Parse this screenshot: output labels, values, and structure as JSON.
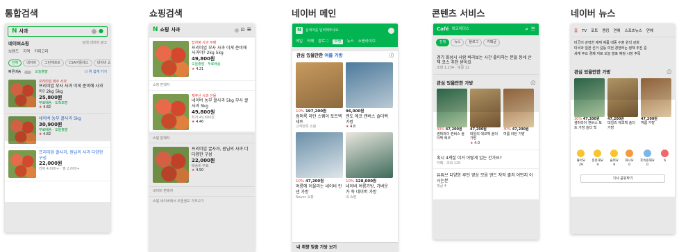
{
  "columns": [
    "통합검색",
    "쇼핑검색",
    "네이버 메인",
    "콘텐츠 서비스",
    "네이버 뉴스"
  ],
  "p1": {
    "logo": "N",
    "query": "사과",
    "section": "네이버쇼핑",
    "section_note": "검색 네이버 광고",
    "tabs": [
      "브랜드",
      "지역",
      "카테고리"
    ],
    "chips": [
      "전체",
      "네이버",
      "그린에프트",
      "CSA아틀래스",
      "네이버 쇼핑"
    ],
    "filters": [
      "빠른배송",
      "오늘출발",
      "나 위 쉽게 가기"
    ],
    "items": [
      {
        "tag": "프리미엄 제수 사과",
        "title": "프리미엄 부사 사과 이게 준비해 사과야? 2kg 5kg",
        "price": "25,800원",
        "sub": "무료배송 · 도착보장"
      },
      {
        "tag": "",
        "title": "네이버 농부 꿀사과 5kg",
        "price": "30,900원",
        "sub": "무료배송 · 오늘출발"
      },
      {
        "tag": "",
        "title": "프리미엄 꿀사과, 원님의 사과 다양한 구성",
        "price": "22,000원",
        "sub": "리뷰 4,000+ · 찜 2,000+"
      }
    ],
    "rating": "4.82"
  },
  "p2": {
    "logo": "N",
    "brand": "쇼핑",
    "query": "사과",
    "items": [
      {
        "tag": "탑차량 사과 부패",
        "title": "프리미엄 부사 사과 이게 준비해 사과야? 2kg 5kg",
        "price": "49,800원",
        "meta": "오늘출발 · 무료배송",
        "store": "쇼핑 판매자",
        "rating": "4.21"
      },
      {
        "tag": "제주산 사과 선물",
        "title": "네이버 농부 꿀사과 5kg 부사 꿀사과 5kg",
        "price": "49,800원",
        "meta": "최저 49,800원",
        "store": "쇼핑 판매자",
        "rating": "4.46"
      },
      {
        "tag": "",
        "title": "프리미엄 꿀사과, 원님의 사과 더 다양한 구성",
        "price": "22,000원",
        "meta": "배송비 무료",
        "store": "네이버 판매자",
        "rating": "4.50"
      }
    ],
    "footer": "쇼핑 네이버에서 쿠폰정보 가져오기"
  },
  "p3": {
    "logo": "N",
    "search_placeholder": "검색어를 입력해주세요.",
    "tabs": [
      "메일",
      "카페",
      "블로그",
      "쇼핑",
      "뉴스",
      "쇼핑라이브"
    ],
    "section": "관심 있을만한",
    "section_hl": "여름 가방",
    "items": [
      {
        "disc": "10%",
        "price": "197,200원",
        "title": "썸머룩 라탄 스퀘어 토트백 세트",
        "store": "고객만족 쇼핑"
      },
      {
        "disc": "",
        "price": "96,000원",
        "title": "렌도 에코 캔버스 숄더백 가방",
        "store": "쇼핑몰",
        "rating": "4.8"
      },
      {
        "disc": "10%",
        "price": "47,200원",
        "title": "여름에 어울리는 네이비 린넨 가방",
        "store": "Naver 쇼핑"
      },
      {
        "disc": "10%",
        "price": "128,000원",
        "title": "네이버 여름가방, 가벼운 가 죽 네이버 가방",
        "store": "내 쇼핑"
      }
    ],
    "footer": "내 취향 맞춤 가방 보기"
  },
  "p4": {
    "logo": "Café",
    "title": "에코데이스",
    "chips": [
      "전체",
      "뉴스",
      "블로그",
      "카페글"
    ],
    "post1": "경기 화성시 사람 바라보는 시간 좋아하는 분들 동네 산책 코스 추천 받아요",
    "post1_meta": "조회 1,234 · 댓글 12",
    "section": "관심 있을만한 가방",
    "items": [
      {
        "disc": "30%",
        "price": "47,200원",
        "title": "썸머라이 캔버스 숄더백 에코"
      },
      {
        "disc": "",
        "price": "47,200원",
        "title": "데일리 에코백 숄더 가방",
        "rating": "4.0"
      },
      {
        "disc": "30%",
        "price": "47,200원",
        "title": "여름 라탄 가방"
      }
    ],
    "post2": "혹시 4계절 이거 어떻게 입는 건가요?",
    "post2_meta": "카페 · 조회 120",
    "post3": "유튜브 다양한 루틴 영상 모음 엔드 자막 출처 어떤지 아시는분",
    "post3_meta": "댓글 4"
  },
  "p5": {
    "tabs": [
      "홈",
      "TV",
      "포토",
      "랭킹",
      "연예",
      "스포츠뉴스",
      "연예"
    ],
    "headlines": [
      "미국이 강력한 제재 제품 대중 수출 원칙 강화",
      "미국과 일본 선거 갈등 여전 경쟁하는 정책 추진 중",
      "세계 주요 경제 지표 오늘 발표 예정 시장 주목"
    ],
    "section": "관심 있을만한 가방",
    "items": [
      {
        "disc": "30%",
        "price": "47,200원",
        "title": "썸머라이 캔버스 토트 가방 숄더 백"
      },
      {
        "disc": "",
        "price": "47,200원",
        "title": "데일리 에코백 숄더 가방"
      },
      {
        "disc": "",
        "price": "47,200원",
        "title": "여름 가방"
      }
    ],
    "reactions": [
      {
        "label": "좋아요",
        "count": "29"
      },
      {
        "label": "훈훈해요",
        "count": "9"
      },
      {
        "label": "슬퍼요",
        "count": "9"
      },
      {
        "label": "화나요",
        "count": "0"
      },
      {
        "label": "후속원해요",
        "count": "0"
      },
      {
        "label": "",
        "count": "6"
      }
    ],
    "more": "기사 공유하기"
  },
  "colors": {
    "green": "#00c73c",
    "cafe": "#03c75a",
    "red": "#e3342f"
  }
}
